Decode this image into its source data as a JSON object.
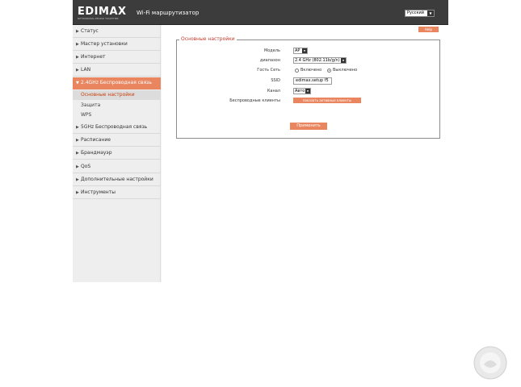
{
  "header": {
    "logo": "EDIMAX",
    "logo_tagline": "NETWORKING PEOPLE TOGETHER",
    "title": "Wi-Fi маршрутизатор",
    "language": "Русский"
  },
  "sidebar": {
    "items": [
      {
        "label": "Статус"
      },
      {
        "label": "Мастер установки"
      },
      {
        "label": "Интернет"
      },
      {
        "label": "LAN"
      },
      {
        "label": "2.4GHz Беспроводная связь"
      },
      {
        "label": "5GHz Беспроводная связь"
      },
      {
        "label": "Расписание"
      },
      {
        "label": "Брандмауэр"
      },
      {
        "label": "QoS"
      },
      {
        "label": "Дополнительные настройки"
      },
      {
        "label": "Инструменты"
      }
    ],
    "subitems": [
      {
        "label": "Основные настройки"
      },
      {
        "label": "Защита"
      },
      {
        "label": "WPS"
      }
    ]
  },
  "content": {
    "help_label": "Help",
    "legend": "Основные настройки",
    "mode_label": "Модель",
    "mode_value": "AP",
    "band_label": "диапазон",
    "band_value": "2.4 GHz (802.11b/g/n)",
    "guest_label": "Гость Сеть",
    "guest_on": "Включено",
    "guest_off": "Выключено",
    "ssid_label": "SSID",
    "ssid_value": "edimax.setup f5",
    "channel_label": "Канал",
    "channel_value": "Авто",
    "clients_label": "Беспроводные клиенты",
    "clients_button": "показать активные клиенты",
    "apply_button": "Применить"
  },
  "colors": {
    "accent": "#e98660",
    "header_bg": "#3c3c3c",
    "legend": "#c0392b"
  },
  "watermark_icon": "gecid-watermark-icon"
}
